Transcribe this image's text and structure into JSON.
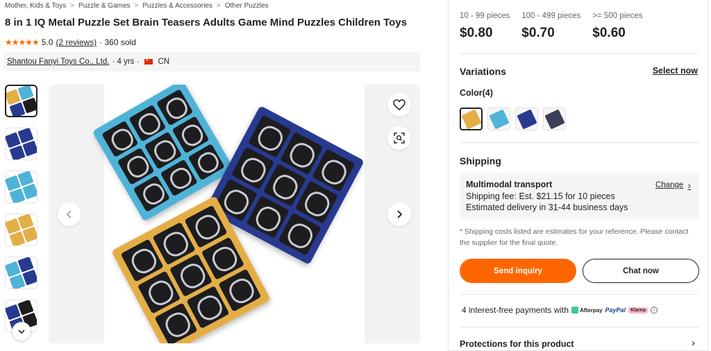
{
  "breadcrumb": [
    "Mother, Kids & Toys",
    "Puzzle & Games",
    "Puzzles & Accessories",
    "Other Puzzles"
  ],
  "breadcrumb_separator": ">",
  "product": {
    "title": "8 in 1 IQ Metal Puzzle Set Brain Teasers Adults Game Mind Puzzles Children Toys",
    "stars": "★★★★★",
    "rating": "5.0",
    "reviews": "(2 reviews)",
    "sold": "· 360 sold"
  },
  "supplier": {
    "name": "Shantou Fanyi Toys Co., Ltd.",
    "years": "· 4 yrs ·",
    "country": "CN"
  },
  "thumbnails": [
    {
      "colors": [
        "#e4ae47",
        "#4fb3d8",
        "#283a8f",
        "#1d1d1f"
      ]
    },
    {
      "colors": [
        "#283a8f",
        "#283a8f",
        "#283a8f",
        "#283a8f"
      ]
    },
    {
      "colors": [
        "#4fb3d8",
        "#4fb3d8",
        "#4fb3d8",
        "#4fb3d8"
      ]
    },
    {
      "colors": [
        "#e4ae47",
        "#e4ae47",
        "#e4ae47",
        "#e4ae47"
      ]
    },
    {
      "colors": [
        "#4fb3d8",
        "#283a8f",
        "#4fb3d8",
        "#283a8f"
      ]
    },
    {
      "colors": [
        "#283a8f",
        "#1d1d1f",
        "#283a8f",
        "#1d1d1f"
      ]
    }
  ],
  "icons": {
    "favorite": "heart-icon",
    "scan": "image-search-icon",
    "prev": "chevron-left-icon",
    "next": "chevron-right-icon",
    "thumb_scroll": "chevron-down-icon"
  },
  "pricing": [
    {
      "range": "10 - 99 pieces",
      "price": "$0.80"
    },
    {
      "range": "100 - 499 pieces",
      "price": "$0.70"
    },
    {
      "range": ">= 500 pieces",
      "price": "$0.60"
    }
  ],
  "variations": {
    "title": "Variations",
    "select_now": "Select now",
    "color_label": "Color(4)",
    "swatches": [
      "#e4ae47",
      "#4fb3d8",
      "#283a8f",
      "#3a3f55"
    ]
  },
  "shipping": {
    "title": "Shipping",
    "mode": "Multimodal transport",
    "change": "Change",
    "fee": "Shipping fee: Est. $21.15 for 10 pieces",
    "delivery": "Estimated delivery in 31-44 business days",
    "note": "* Shipping costs listed are estimates for your reference. Please contact the supplier for the final quote."
  },
  "actions": {
    "inquiry": "Send inquiry",
    "chat": "Chat now"
  },
  "payments": {
    "text": "4 interest-free payments with",
    "afterpay": "Afterpay",
    "paypal": "PayPal",
    "klarna": "Klarna"
  },
  "protections": "Protections for this product",
  "colors": {
    "accent": "#ff6600",
    "star": "#ff6a00"
  }
}
